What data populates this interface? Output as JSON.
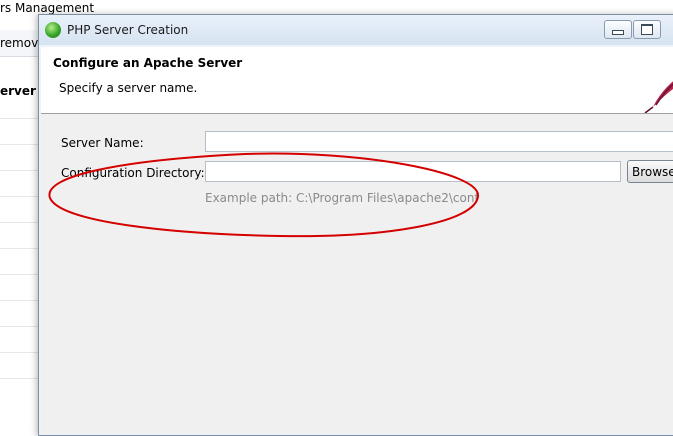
{
  "background": {
    "window_title_fragment": "rs Management",
    "toolbar_fragment": "remov",
    "column_header_fragment": "erver ("
  },
  "dialog": {
    "title": "PHP Server Creation",
    "banner": {
      "heading": "Configure an Apache Server",
      "description": "Specify a server name."
    },
    "form": {
      "server_name_label": "Server Name:",
      "server_name_value": "",
      "config_dir_label": "Configuration Directory:",
      "config_dir_value": "",
      "browse_label": "Browse",
      "example_path": "Example path: C:\\Program Files\\apache2\\conf"
    }
  },
  "colors": {
    "annotation": "#d40000",
    "accent_icon": "#39a52a"
  },
  "icons": [
    "php-server-icon",
    "minimize-icon",
    "maximize-icon",
    "apache-feather-icon"
  ]
}
